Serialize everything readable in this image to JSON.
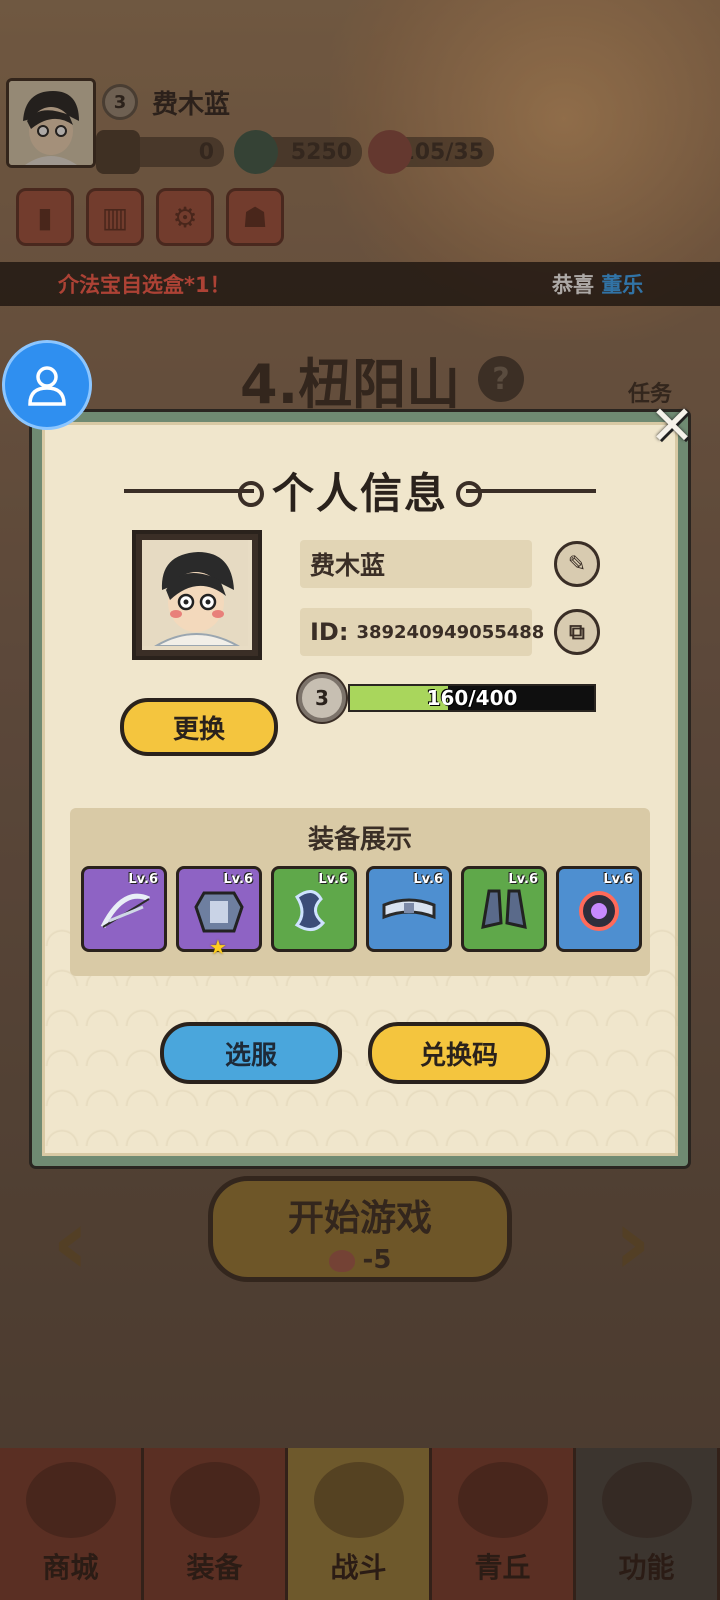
{
  "hud": {
    "player_level": "3",
    "player_name": "费木蓝",
    "resources": [
      {
        "icon": "ticket-icon",
        "value": "0"
      },
      {
        "icon": "jade-coin-icon",
        "value": "5250"
      },
      {
        "icon": "peach-stamina-icon",
        "value": "105/35"
      }
    ],
    "menu_icons": [
      "card-icon",
      "rank-chart-icon",
      "settings-gear-icon",
      "friends-icon"
    ]
  },
  "ticker": {
    "left_text": "介法宝自选盒*1！",
    "right_prefix": "恭喜",
    "right_name": "董乐"
  },
  "stage": {
    "title": "4.杻阳山",
    "help": "?",
    "task_label": "任务"
  },
  "start": {
    "label": "开始游戏",
    "cost": "-5"
  },
  "nav": [
    {
      "label": "商城",
      "icon": "shop-icon"
    },
    {
      "label": "装备",
      "icon": "helmet-icon"
    },
    {
      "label": "战斗",
      "icon": "crossed-swords-icon"
    },
    {
      "label": "青丘",
      "icon": "mountain-icon"
    },
    {
      "label": "功能",
      "icon": "locked-icon"
    }
  ],
  "modal": {
    "title": "个人信息",
    "name": "费木蓝",
    "id_label": "ID:",
    "id_value": "389240949055488",
    "level": "3",
    "xp_text": "160/400",
    "xp_progress": 0.4,
    "change_button": "更换",
    "equip_title": "装备展示",
    "equipment": [
      {
        "rarity": "purple",
        "level": "Lv.6",
        "icon": "bow-icon",
        "starred": false
      },
      {
        "rarity": "purple",
        "level": "Lv.6",
        "icon": "armor-icon",
        "starred": true
      },
      {
        "rarity": "green",
        "level": "Lv.6",
        "icon": "bracer-icon",
        "starred": false
      },
      {
        "rarity": "blue",
        "level": "Lv.6",
        "icon": "belt-icon",
        "starred": false
      },
      {
        "rarity": "green",
        "level": "Lv.6",
        "icon": "boots-icon",
        "starred": false
      },
      {
        "rarity": "blue",
        "level": "Lv.6",
        "icon": "orb-ring-icon",
        "starred": false
      }
    ],
    "server_button": "选服",
    "redeem_button": "兑换码",
    "close": "✕"
  },
  "colors": {
    "modal_bg": "#f0e6cc",
    "modal_border": "#6f8a72",
    "yellow_button": "#f4c53e",
    "blue_button": "#4aa6dc",
    "xp_fill": "#a9d65c",
    "rarity_purple": "#8e63c4",
    "rarity_green": "#5fa84a",
    "rarity_blue": "#4e8fd0"
  }
}
